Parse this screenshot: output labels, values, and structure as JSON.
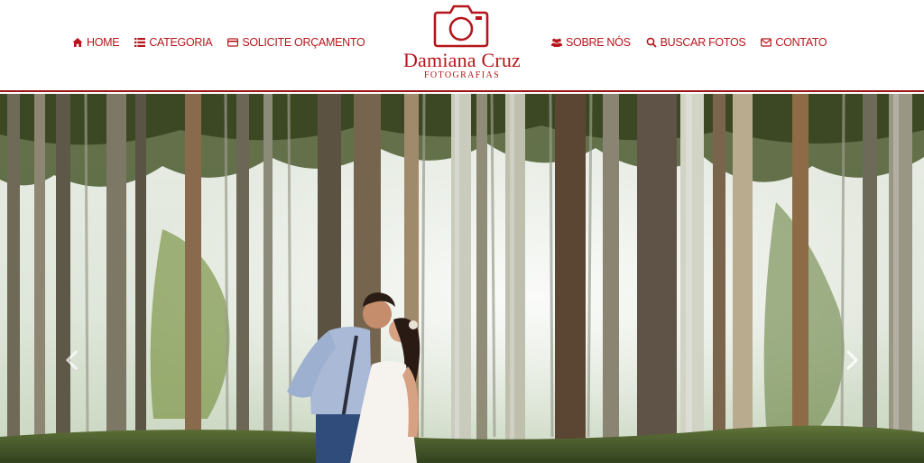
{
  "nav_left": [
    {
      "label": "HOME",
      "icon": "home-icon"
    },
    {
      "label": "CATEGORIA",
      "icon": "list-icon"
    },
    {
      "label": "SOLICITE ORÇAMENTO",
      "icon": "credit-card-icon"
    }
  ],
  "nav_right": [
    {
      "label": "SOBRE NÓS",
      "icon": "users-icon"
    },
    {
      "label": "BUSCAR FOTOS",
      "icon": "search-icon"
    },
    {
      "label": "CONTATO",
      "icon": "envelope-icon"
    }
  ],
  "logo": {
    "name": "Damiana Cruz",
    "subtitle": "FOTOGRAFIAS",
    "icon": "camera-icon"
  },
  "slider": {
    "prev_icon": "chevron-left-icon",
    "next_icon": "chevron-right-icon"
  },
  "colors": {
    "brand": "#b5161b",
    "header_border": "#9a1416"
  }
}
